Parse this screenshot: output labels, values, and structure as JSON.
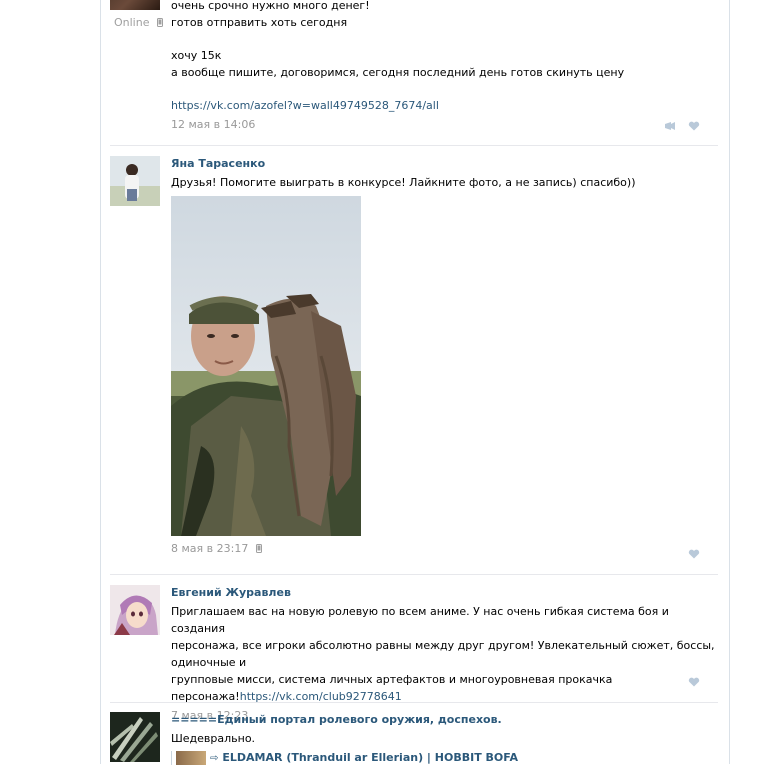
{
  "posts": [
    {
      "status_label": "Online",
      "lines": [
        "очень срочно нужно много денег!",
        "готов отправить хоть сегодня",
        "хочу 15к",
        "а вообще пишите, договоримся, сегодня последний день готов скинуть цену"
      ],
      "link": "https://vk.com/azofel?w=wall49749528_7674/all",
      "date": "12 мая в 14:06"
    },
    {
      "author": "Яна Тарасенко",
      "text": "Друзья! Помогите выиграть в конкурсе! Лайкните фото, а не запись) спасибо))",
      "date": "8 мая в 23:17"
    },
    {
      "author": "Евгений Журавлев",
      "text_lines": [
        "Приглашаем вас на новую ролевую по всем аниме. У нас очень гибкая система боя и создания",
        "персонажа, все игроки абсолютно равны между друг другом! Увлекательный сюжет, боссы, одиночные и",
        "групповые мисси, система личных артефактов и многоуровневая прокачка"
      ],
      "last_line_prefix": "персонажа!",
      "link": "https://vk.com/club92778641",
      "date": "7 мая в 12:23"
    },
    {
      "author": "=====Единый портал ролевого оружия, доспехов.",
      "text": "Шедеврально.",
      "repost": "ELDAMAR (Thranduil ar Ellerian) | HOBBIT BOFA"
    }
  ],
  "colors": {
    "link": "#2b587a",
    "meta": "#999999",
    "icon": "#b9c9d9"
  }
}
